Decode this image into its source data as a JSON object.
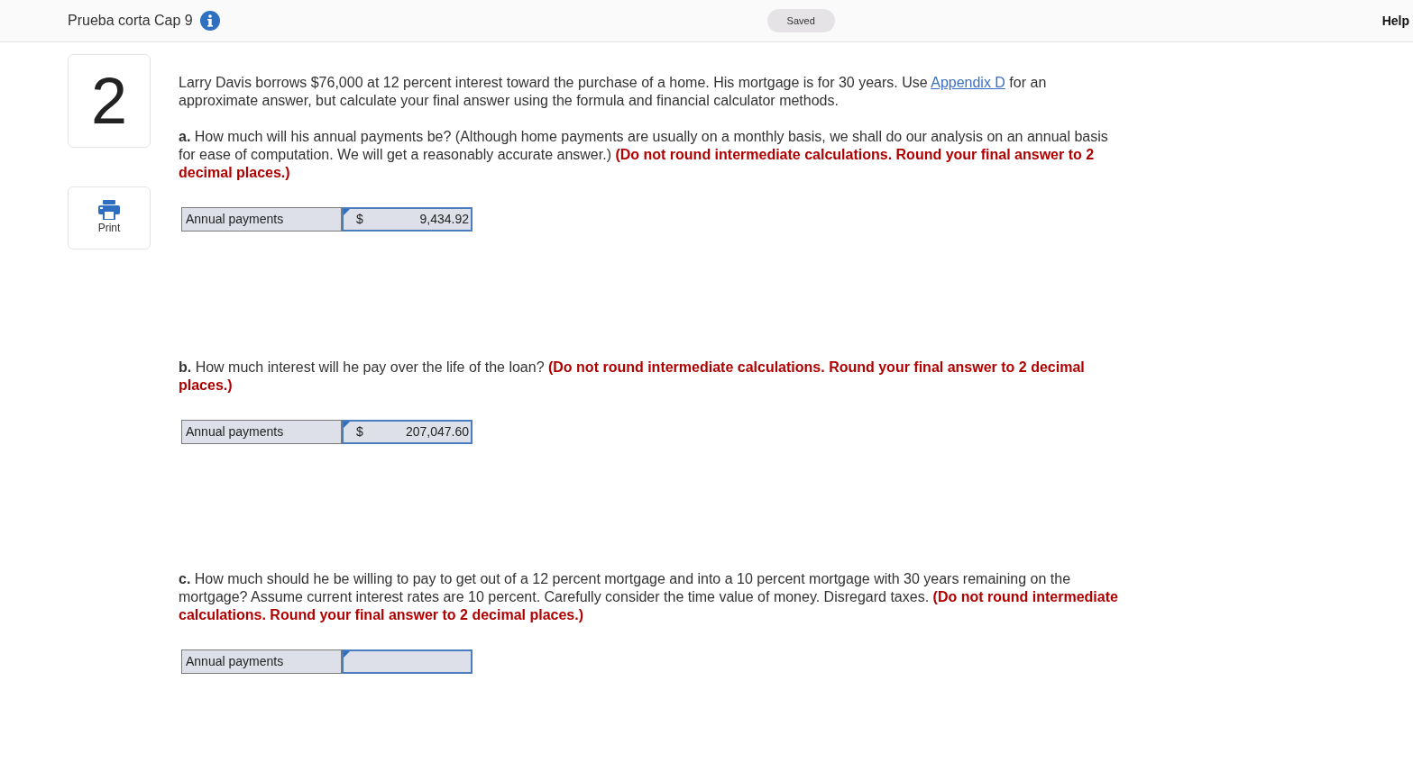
{
  "header": {
    "title": "Prueba corta Cap 9",
    "status": "Saved",
    "help": "Help"
  },
  "question_number": "2",
  "print_label": "Print",
  "intro": {
    "before": "Larry Davis borrows $76,000 at 12 percent interest toward the purchase of a home. His mortgage is for 30 years. Use",
    "link": "Appendix D",
    "after": "for an approximate answer, but calculate your final answer using the formula and financial calculator methods."
  },
  "parts": [
    {
      "text": "**a.** How much will his annual payments be? (Although home payments are usually on a monthly basis, we shall do our analysis on an annual basis for ease of computation. We will get a reasonably accurate answer.)",
      "instruction": "(Do not round intermediate calculations. Round your final answer to 2 decimal places.)",
      "answer": {
        "label": "Annual payments",
        "currency": "$",
        "value": "9,434.92"
      }
    },
    {
      "text": "**b.** How much interest will he pay over the life of the loan?",
      "instruction": "(Do not round intermediate calculations. Round your final answer to 2 decimal places.)",
      "answer": {
        "label": "Annual payments",
        "currency": "$",
        "value": "207,047.60"
      }
    },
    {
      "text": "**c.** How much should he be willing to pay to get out of a 12 percent mortgage and into a 10 percent mortgage with 30 years remaining on the mortgage? Assume current interest rates are 10 percent. Carefully consider the time value of money. Disregard taxes.",
      "instruction": "(Do not round intermediate calculations. Round your final answer to 2 decimal places.)",
      "answer": {
        "label": "Annual payments"
      }
    }
  ]
}
